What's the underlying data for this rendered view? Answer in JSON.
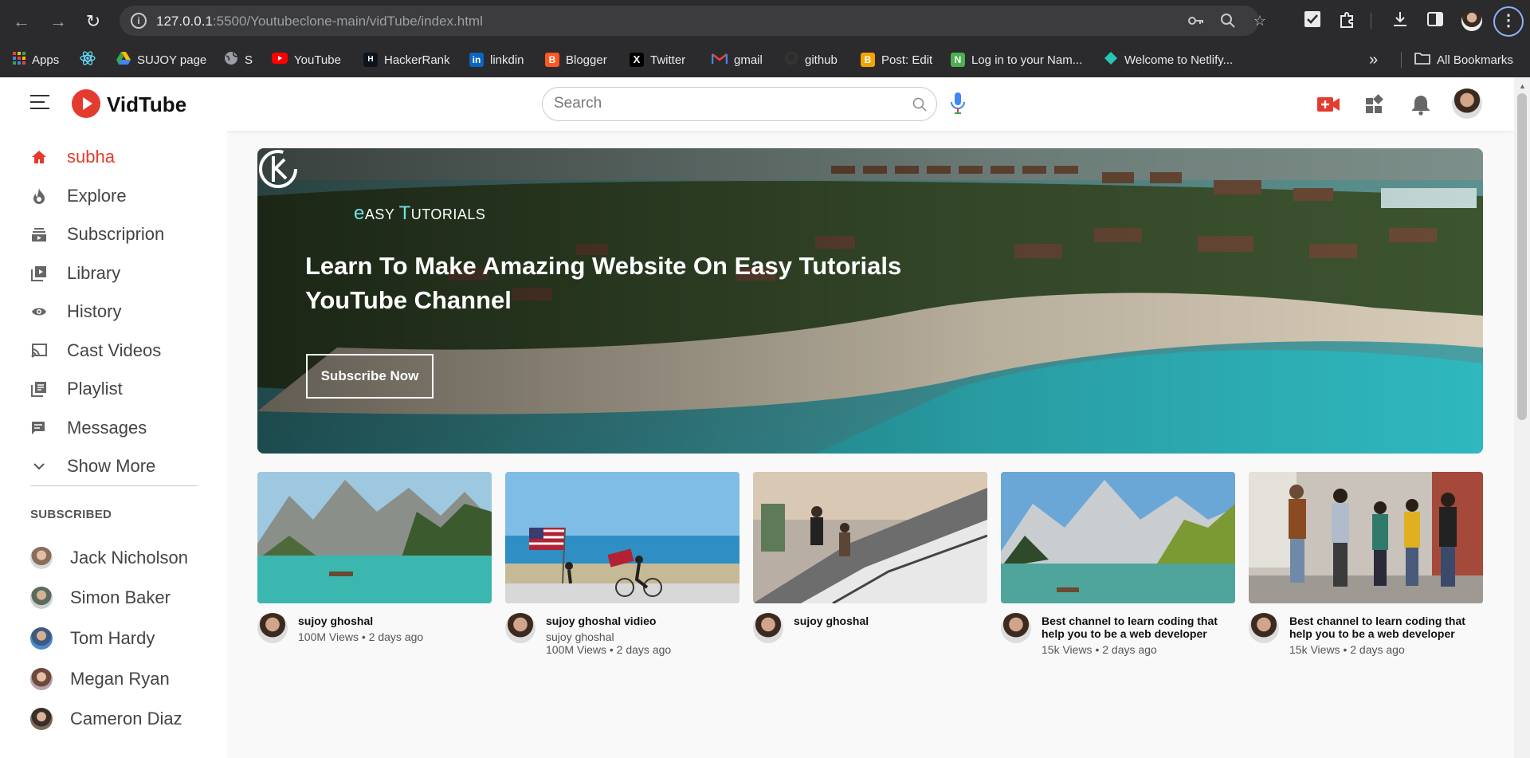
{
  "browser": {
    "url_host": "127.0.0.1",
    "url_rest": ":5500/Youtubeclone-main/vidTube/index.html",
    "bookmarks": [
      {
        "label": "Apps",
        "icon": "apps-grid-icon",
        "color": "#4285f4"
      },
      {
        "label": "",
        "icon": "react-icon",
        "color": "#61dafb"
      },
      {
        "label": "SUJOY page",
        "icon": "google-drive-icon",
        "color": "#fbbc04"
      },
      {
        "label": "S",
        "icon": "globe-icon",
        "color": "#9aa0a6"
      },
      {
        "label": "YouTube",
        "icon": "youtube-icon",
        "color": "#ff0000"
      },
      {
        "label": "HackerRank",
        "icon": "hackerrank-icon",
        "color": "#1ba94c"
      },
      {
        "label": "linkdin",
        "icon": "linkedin-icon",
        "color": "#0a66c2"
      },
      {
        "label": "Blogger",
        "icon": "blogger-icon",
        "color": "#ff5722"
      },
      {
        "label": "Twitter",
        "icon": "x-icon",
        "color": "#000000"
      },
      {
        "label": "gmail",
        "icon": "gmail-icon",
        "color": "#ea4335"
      },
      {
        "label": "github",
        "icon": "github-icon",
        "color": "#333333"
      },
      {
        "label": "Post: Edit",
        "icon": "blogger-icon",
        "color": "#f4a300"
      },
      {
        "label": "Log in to your Nam...",
        "icon": "namecheap-icon",
        "color": "#4caf50"
      },
      {
        "label": "Welcome to Netlify...",
        "icon": "netlify-icon",
        "color": "#25c7b7"
      }
    ],
    "overflow": "»",
    "all_bookmarks": "All Bookmarks"
  },
  "header": {
    "logo_text": "VidTube",
    "search_placeholder": "Search"
  },
  "sidebar": {
    "items": [
      {
        "label": "subha",
        "icon": "home-icon"
      },
      {
        "label": "Explore",
        "icon": "fire-icon"
      },
      {
        "label": "Subscriprion",
        "icon": "subscriptions-icon"
      },
      {
        "label": "Library",
        "icon": "library-icon"
      },
      {
        "label": "History",
        "icon": "eye-icon"
      },
      {
        "label": "Cast Videos",
        "icon": "cast-icon"
      },
      {
        "label": "Playlist",
        "icon": "playlist-icon"
      },
      {
        "label": "Messages",
        "icon": "messages-icon"
      },
      {
        "label": "Show More",
        "icon": "chevron-down-icon"
      }
    ],
    "subscribed_heading": "SUBSCRIBED",
    "subscriptions": [
      {
        "name": "Jack Nicholson",
        "avatar_color": "#8a6d5a"
      },
      {
        "name": "Simon Baker",
        "avatar_color": "#5a6b5c"
      },
      {
        "name": "Tom Hardy",
        "avatar_color": "#4a88c7"
      },
      {
        "name": "Megan Ryan",
        "avatar_color": "#8b6b7a"
      },
      {
        "name": "Cameron Diaz",
        "avatar_color": "#5b4a3a"
      }
    ]
  },
  "banner": {
    "brand_prefix": "e",
    "brand_rest": "ASY ",
    "brand_t": "T",
    "brand_end": "UTORIALS",
    "title": "Learn To Make Amazing Website On Easy Tutorials YouTube Channel",
    "button": "Subscribe Now"
  },
  "videos": [
    {
      "title": "sujoy ghoshal",
      "channel": "",
      "stats": "100M Views • 2 days ago",
      "scene": "lake-mountains"
    },
    {
      "title": "sujoy ghoshal vidieo",
      "channel": "sujoy ghoshal",
      "stats": "100M Views • 2 days ago",
      "scene": "beach-flag"
    },
    {
      "title": "sujoy ghoshal",
      "channel": "",
      "stats": "",
      "scene": "escalator"
    },
    {
      "title": "Best channel to learn coding that help you to be a web developer",
      "channel": "",
      "stats": "15k Views • 2 days ago",
      "scene": "alpine-lake"
    },
    {
      "title": "Best channel to learn coding that help you to be a web developer",
      "channel": "",
      "stats": "15k Views • 2 days ago",
      "scene": "friends-walking"
    }
  ]
}
